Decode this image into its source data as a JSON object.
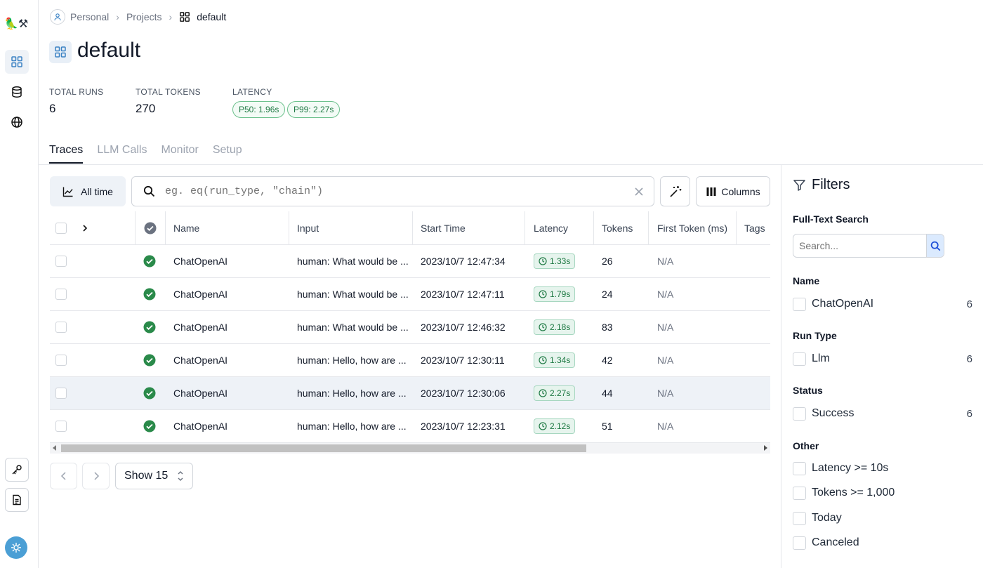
{
  "breadcrumb": {
    "items": [
      "Personal",
      "Projects"
    ],
    "current": "default"
  },
  "page": {
    "title": "default"
  },
  "stats": {
    "total_runs_label": "TOTAL RUNS",
    "total_runs": "6",
    "total_tokens_label": "TOTAL TOKENS",
    "total_tokens": "270",
    "latency_label": "LATENCY",
    "p50": "P50: 1.96s",
    "p99": "P99: 2.27s"
  },
  "tabs": [
    {
      "label": "Traces",
      "active": true
    },
    {
      "label": "LLM Calls",
      "active": false
    },
    {
      "label": "Monitor",
      "active": false
    },
    {
      "label": "Setup",
      "active": false
    }
  ],
  "toolbar": {
    "time_range": "All time",
    "search_placeholder": "eg. eq(run_type, \"chain\")",
    "columns_label": "Columns"
  },
  "table": {
    "headers": [
      "Name",
      "Input",
      "Start Time",
      "Latency",
      "Tokens",
      "First Token (ms)",
      "Tags"
    ],
    "rows": [
      {
        "name": "ChatOpenAI",
        "input": "human: What would be ...",
        "start_time": "2023/10/7 12:47:34",
        "latency": "1.33s",
        "tokens": "26",
        "first_token": "N/A"
      },
      {
        "name": "ChatOpenAI",
        "input": "human: What would be ...",
        "start_time": "2023/10/7 12:47:11",
        "latency": "1.79s",
        "tokens": "24",
        "first_token": "N/A"
      },
      {
        "name": "ChatOpenAI",
        "input": "human: What would be ...",
        "start_time": "2023/10/7 12:46:32",
        "latency": "2.18s",
        "tokens": "83",
        "first_token": "N/A"
      },
      {
        "name": "ChatOpenAI",
        "input": "human: Hello, how are ...",
        "start_time": "2023/10/7 12:30:11",
        "latency": "1.34s",
        "tokens": "42",
        "first_token": "N/A"
      },
      {
        "name": "ChatOpenAI",
        "input": "human: Hello, how are ...",
        "start_time": "2023/10/7 12:30:06",
        "latency": "2.27s",
        "tokens": "44",
        "first_token": "N/A"
      },
      {
        "name": "ChatOpenAI",
        "input": "human: Hello, how are ...",
        "start_time": "2023/10/7 12:23:31",
        "latency": "2.12s",
        "tokens": "51",
        "first_token": "N/A"
      }
    ]
  },
  "pagination": {
    "show_label": "Show 15"
  },
  "filters": {
    "title": "Filters",
    "fulltext_label": "Full-Text Search",
    "search_placeholder": "Search...",
    "name_label": "Name",
    "name_option": "ChatOpenAI",
    "name_count": "6",
    "runtype_label": "Run Type",
    "runtype_option": "Llm",
    "runtype_count": "6",
    "status_label": "Status",
    "status_option": "Success",
    "status_count": "6",
    "other_label": "Other",
    "other_options": [
      "Latency >= 10s",
      "Tokens >= 1,000",
      "Today",
      "Canceled"
    ]
  },
  "colors": {
    "success": "#2a8a4a",
    "accent": "#2563eb",
    "highlight_row": "#eef2f7"
  }
}
